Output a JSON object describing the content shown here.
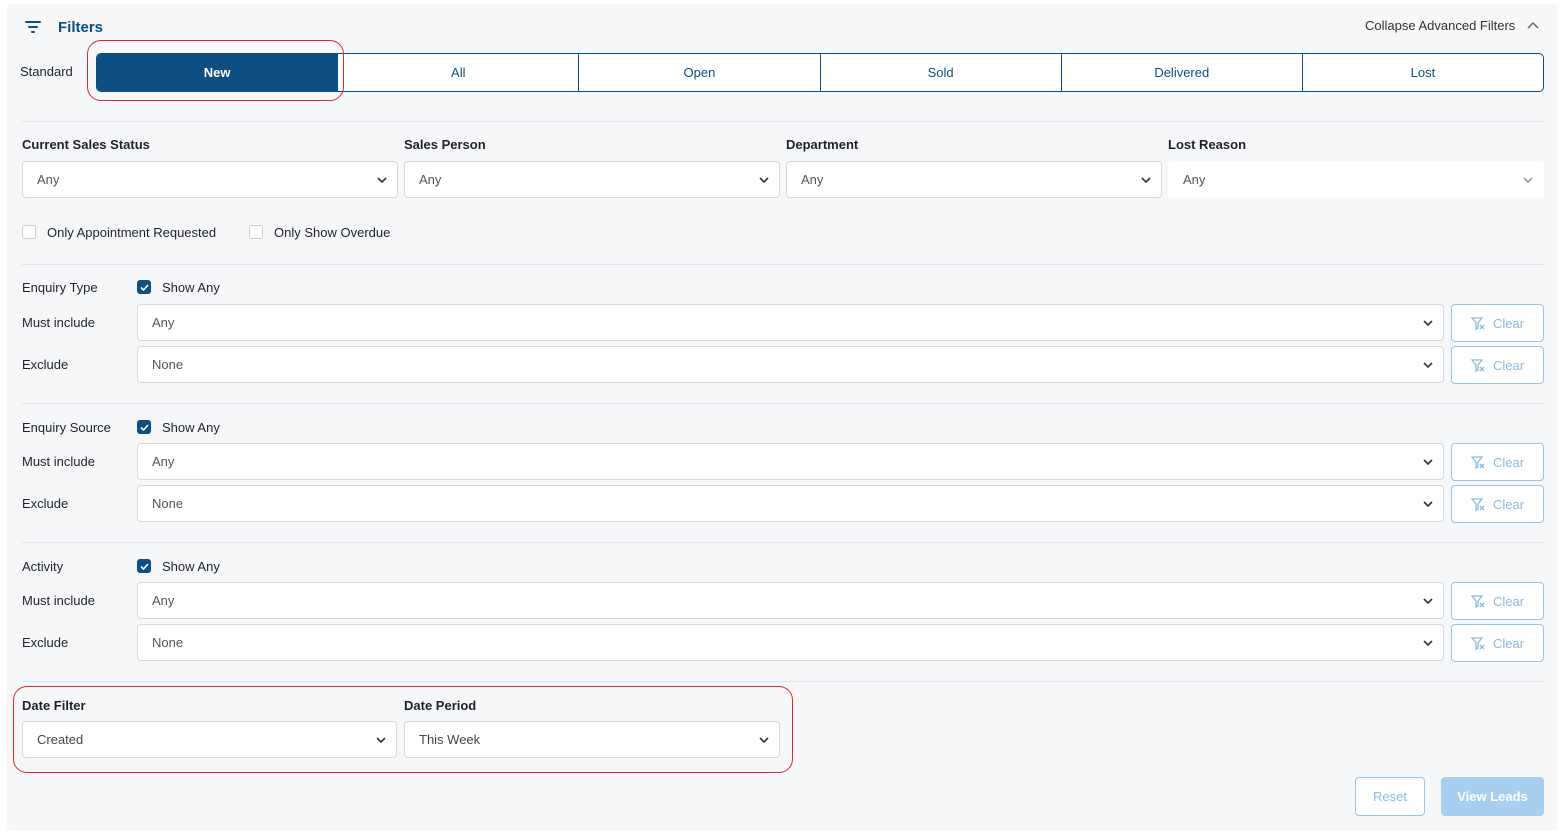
{
  "header": {
    "title": "Filters",
    "collapse_label": "Collapse Advanced Filters"
  },
  "standard": {
    "label": "Standard",
    "tabs": [
      "New",
      "All",
      "Open",
      "Sold",
      "Delivered",
      "Lost"
    ],
    "active": "New"
  },
  "top_filters": [
    {
      "label": "Current Sales Status",
      "value": "Any"
    },
    {
      "label": "Sales Person",
      "value": "Any"
    },
    {
      "label": "Department",
      "value": "Any"
    },
    {
      "label": "Lost Reason",
      "value": "Any"
    }
  ],
  "toggles": {
    "appointment": "Only Appointment Requested",
    "overdue": "Only Show Overdue"
  },
  "groups": [
    {
      "label": "Enquiry Type",
      "show_any": "Show Any",
      "must_label": "Must include",
      "must_value": "Any",
      "exclude_label": "Exclude",
      "exclude_value": "None"
    },
    {
      "label": "Enquiry Source",
      "show_any": "Show Any",
      "must_label": "Must include",
      "must_value": "Any",
      "exclude_label": "Exclude",
      "exclude_value": "None"
    },
    {
      "label": "Activity",
      "show_any": "Show Any",
      "must_label": "Must include",
      "must_value": "Any",
      "exclude_label": "Exclude",
      "exclude_value": "None"
    }
  ],
  "clear_label": "Clear",
  "date": {
    "filter_label": "Date Filter",
    "filter_value": "Created",
    "period_label": "Date Period",
    "period_value": "This Week"
  },
  "actions": {
    "reset": "Reset",
    "view": "View Leads"
  },
  "colors": {
    "primary": "#0d4f82",
    "annotation": "#e02828",
    "disabled": "#a8cff0"
  }
}
